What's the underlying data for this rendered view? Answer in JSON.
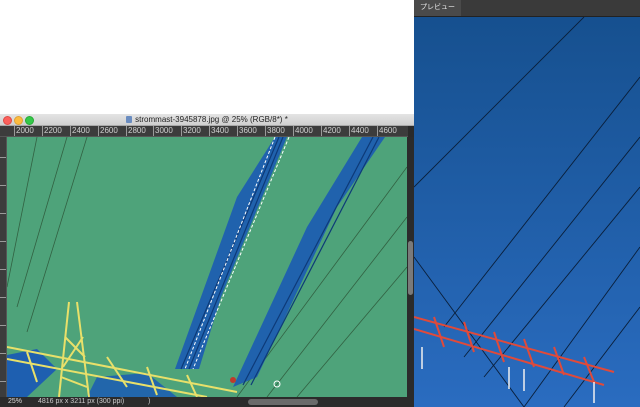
{
  "document": {
    "title": "strommast-3945878.jpg @ 25% (RGB/8*) *",
    "ruler_ticks": [
      "2000",
      "2200",
      "2400",
      "2600",
      "2800",
      "3000",
      "3200",
      "3400",
      "3600",
      "3800",
      "4000",
      "4200",
      "4400",
      "4600"
    ],
    "status": {
      "zoom": "25%",
      "info": "4816 px x 3211 px (300 ppi)",
      "arrow": ")"
    }
  },
  "preview": {
    "tab_label": "プレビュー"
  },
  "colors": {
    "canvas_bg": "#4ea37a",
    "mask_blue": "#1e5fb0",
    "pylon_yellow": "#e8e06a",
    "preview_sky": "#1b5ea8",
    "preview_red": "#e04a3a"
  }
}
